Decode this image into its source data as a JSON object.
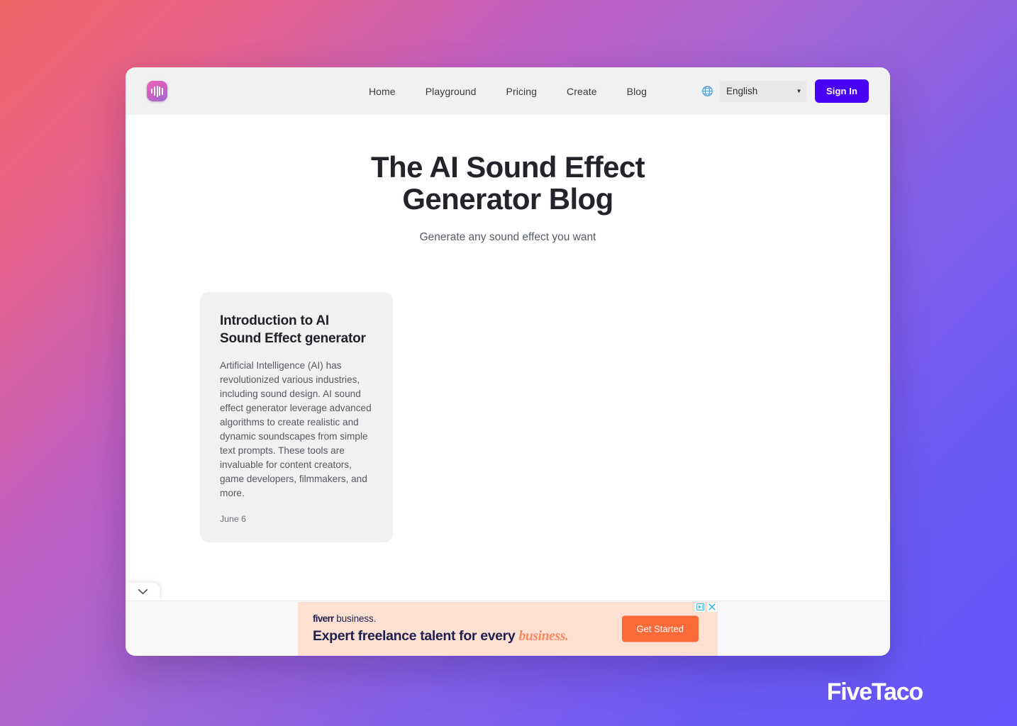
{
  "background": {
    "gradient_start": "#ef6565",
    "gradient_mid": "#a265d5",
    "gradient_end": "#6457fc"
  },
  "watermark": {
    "text": "FiveTaco"
  },
  "header": {
    "logo_name": "sound-wave-logo",
    "nav": [
      {
        "label": "Home"
      },
      {
        "label": "Playground"
      },
      {
        "label": "Pricing"
      },
      {
        "label": "Create"
      },
      {
        "label": "Blog"
      }
    ],
    "language": {
      "icon": "globe-icon",
      "selected": "English",
      "options": [
        "English"
      ]
    },
    "signin_label": "Sign In",
    "signin_color": "#4a00f5"
  },
  "hero": {
    "title_line1": "The AI Sound Effect",
    "title_line2": "Generator Blog",
    "subtitle": "Generate any sound effect you want"
  },
  "blog": {
    "posts": [
      {
        "title": "Introduction to AI Sound Effect generator",
        "excerpt": "Artificial Intelligence (AI) has revolutionized various industries, including sound design. AI sound effect generator leverage advanced algorithms to create realistic and dynamic soundscapes from simple text prompts. These tools are invaluable for content creators, game developers, filmmakers, and more.",
        "date": "June 6"
      }
    ]
  },
  "collapse_tab": {
    "icon": "chevron-down-icon"
  },
  "ad": {
    "brand_mark": "fiverr",
    "brand_suffix": " business.",
    "headline_main": "Expert freelance talent for every ",
    "headline_accent": "business.",
    "cta_label": "Get Started",
    "adchoices_icon": "adchoices-icon",
    "close_icon": "close-icon",
    "bg_color": "#fce0d2",
    "cta_color": "#fa6a39"
  }
}
